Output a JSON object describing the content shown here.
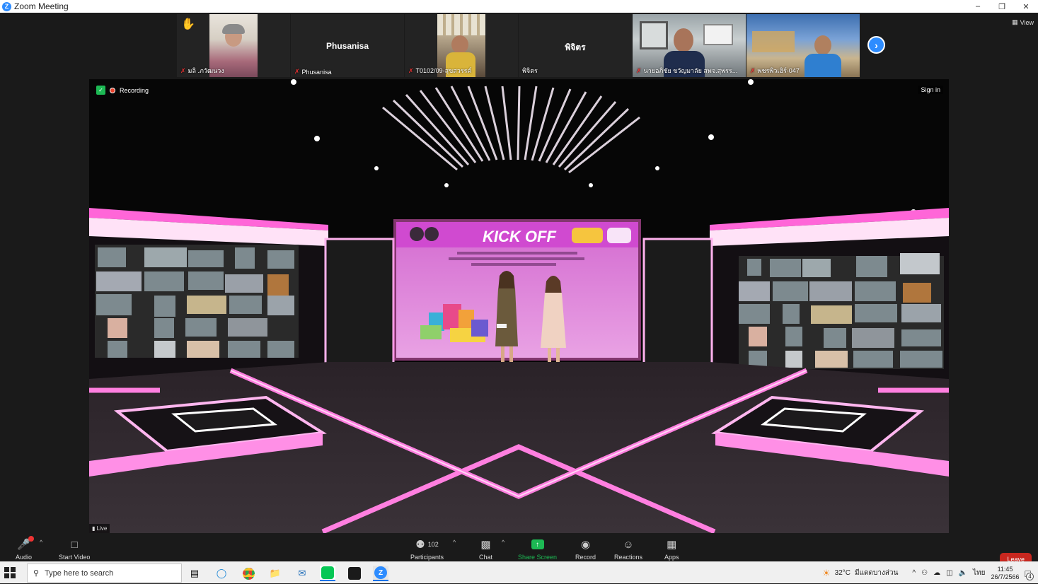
{
  "window": {
    "title": "Zoom Meeting"
  },
  "gallery": {
    "tiles": [
      {
        "name": "มลิ .ภวัฒนวง",
        "hand": "raised-hand-icon",
        "muted": true
      },
      {
        "name": "Phusanisa",
        "big_name": "Phusanisa",
        "muted": true
      },
      {
        "name": "T0102/09-สุขสวรรค์",
        "muted": true
      },
      {
        "name": "พิจิตร",
        "big_name": "พิจิตร",
        "muted": false
      },
      {
        "name": "นายอภิชัย ขวัญมาลัย สพจ.สุพรร...",
        "muted": true
      },
      {
        "name": "พชรพิวเฮิร์-047",
        "muted": true
      }
    ],
    "view_label": "View"
  },
  "main": {
    "recording_label": "Recording",
    "signin_label": "Sign in",
    "live_label": "Live",
    "slide_title": "KICK OFF"
  },
  "toolbar": {
    "audio": "Audio",
    "start_video": "Start Video",
    "participants": "Participants",
    "participants_count": "102",
    "chat": "Chat",
    "share_screen": "Share Screen",
    "record": "Record",
    "reactions": "Reactions",
    "apps": "Apps",
    "leave": "Leave"
  },
  "taskbar": {
    "search_placeholder": "Type here to search",
    "weather": "32°C",
    "weather_desc": "มีแดดบางส่วน",
    "lang": "ไทย",
    "time": "11:45",
    "date": "26/7/2566",
    "notif_count": "4"
  },
  "colors": {
    "zoom_blue": "#2d8cff",
    "leave_red": "#c8271f",
    "share_green": "#1db954",
    "stage_pink": "#ff4fd0"
  }
}
